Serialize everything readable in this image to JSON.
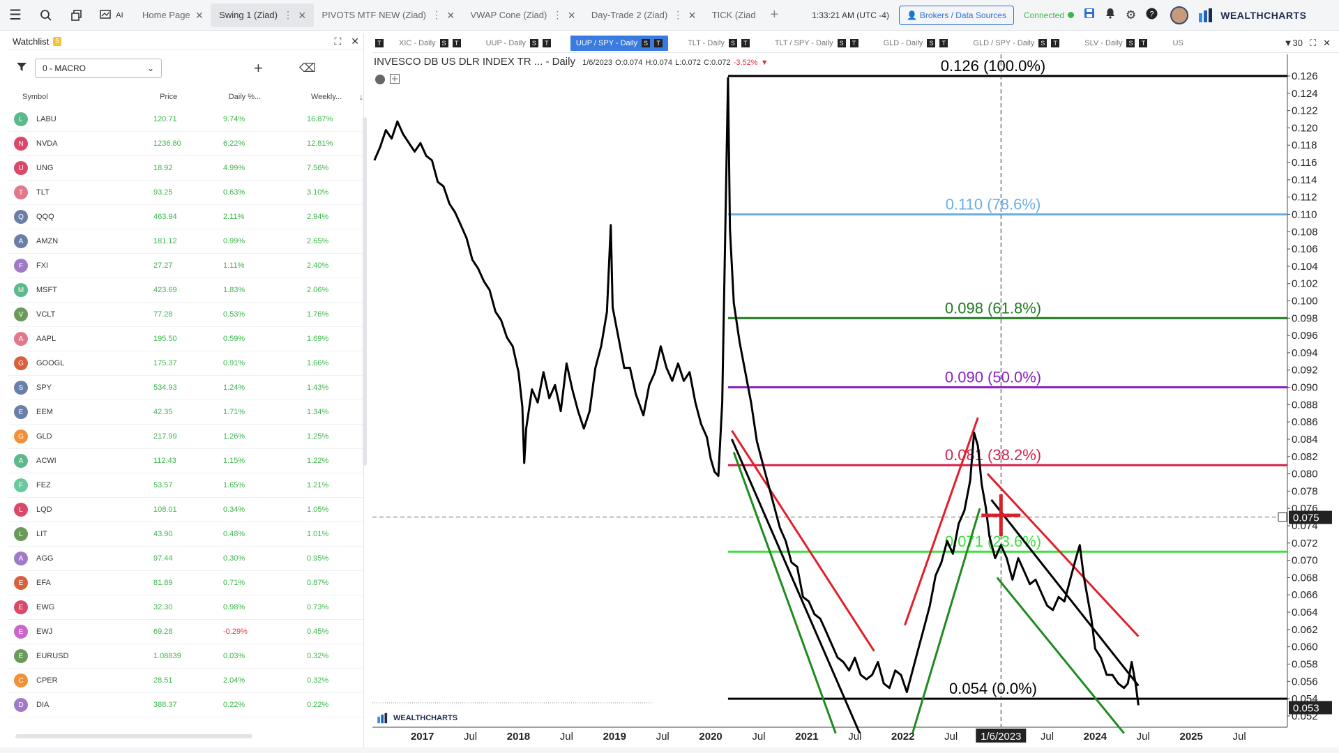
{
  "topbar": {
    "tabs": [
      {
        "label": "Home Page",
        "has_menu": false
      },
      {
        "label": "Swing 1 (Ziad)",
        "has_menu": true,
        "active": true
      },
      {
        "label": "PIVOTS MTF NEW (Ziad)",
        "has_menu": true
      },
      {
        "label": "VWAP Cone (Ziad)",
        "has_menu": true
      },
      {
        "label": "Day-Trade 2 (Ziad)",
        "has_menu": true
      },
      {
        "label": "TICK (Ziad",
        "has_menu": false
      }
    ],
    "clock": "1:33:21 AM  (UTC -4)",
    "brokers_label": "Brokers / Data Sources",
    "connection": "Connected",
    "brand": "WEALTHCHARTS",
    "ai_label": "AI"
  },
  "watchlist": {
    "title": "Watchlist",
    "badge": "5",
    "list_name": "0 - MACRO",
    "columns": [
      "Symbol",
      "Price",
      "Daily %...",
      "Weekly..."
    ],
    "rows": [
      {
        "sym": "LABU",
        "price": "120.71",
        "daily": "9.74%",
        "weekly": "16.87%",
        "color": "#5bb98c"
      },
      {
        "sym": "NVDA",
        "price": "1236.80",
        "daily": "6.22%",
        "weekly": "12.81%",
        "color": "#d94a6a"
      },
      {
        "sym": "UNG",
        "price": "18.92",
        "daily": "4.99%",
        "weekly": "7.56%",
        "color": "#d94a6a"
      },
      {
        "sym": "TLT",
        "price": "93.25",
        "daily": "0.63%",
        "weekly": "3.10%",
        "color": "#e07a8a"
      },
      {
        "sym": "QQQ",
        "price": "463.94",
        "daily": "2.11%",
        "weekly": "2.94%",
        "color": "#6a7fa8"
      },
      {
        "sym": "AMZN",
        "price": "181.12",
        "daily": "0.99%",
        "weekly": "2.65%",
        "color": "#6a7fa8"
      },
      {
        "sym": "FXI",
        "price": "27.27",
        "daily": "1.11%",
        "weekly": "2.40%",
        "color": "#a07ac8"
      },
      {
        "sym": "MSFT",
        "price": "423.69",
        "daily": "1.83%",
        "weekly": "2.06%",
        "color": "#5bb98c"
      },
      {
        "sym": "VCLT",
        "price": "77.28",
        "daily": "0.53%",
        "weekly": "1.76%",
        "color": "#6a9a5a"
      },
      {
        "sym": "AAPL",
        "price": "195.50",
        "daily": "0.59%",
        "weekly": "1.69%",
        "color": "#e07a8a"
      },
      {
        "sym": "GOOGL",
        "price": "175.37",
        "daily": "0.91%",
        "weekly": "1.66%",
        "color": "#d9603a"
      },
      {
        "sym": "SPY",
        "price": "534.93",
        "daily": "1.24%",
        "weekly": "1.43%",
        "color": "#6a7fa8"
      },
      {
        "sym": "EEM",
        "price": "42.35",
        "daily": "1.71%",
        "weekly": "1.34%",
        "color": "#6a7fa8"
      },
      {
        "sym": "GLD",
        "price": "217.99",
        "daily": "1.26%",
        "weekly": "1.25%",
        "color": "#f0913a"
      },
      {
        "sym": "ACWI",
        "price": "112.43",
        "daily": "1.15%",
        "weekly": "1.22%",
        "color": "#5bb98c"
      },
      {
        "sym": "FEZ",
        "price": "53.57",
        "daily": "1.65%",
        "weekly": "1.21%",
        "color": "#6ac8a0"
      },
      {
        "sym": "LQD",
        "price": "108.01",
        "daily": "0.34%",
        "weekly": "1.05%",
        "color": "#d94a6a"
      },
      {
        "sym": "LIT",
        "price": "43.90",
        "daily": "0.48%",
        "weekly": "1.01%",
        "color": "#6a9a5a"
      },
      {
        "sym": "AGG",
        "price": "97.44",
        "daily": "0.30%",
        "weekly": "0.95%",
        "color": "#a07ac8"
      },
      {
        "sym": "EFA",
        "price": "81.89",
        "daily": "0.71%",
        "weekly": "0.87%",
        "color": "#d9603a"
      },
      {
        "sym": "EWG",
        "price": "32.30",
        "daily": "0.98%",
        "weekly": "0.73%",
        "color": "#d94a6a"
      },
      {
        "sym": "EWJ",
        "price": "69.28",
        "daily": "-0.29%",
        "weekly": "0.45%",
        "color": "#c868c8",
        "daily_neg": true
      },
      {
        "sym": "EURUSD",
        "price": "1.08839",
        "daily": "0.03%",
        "weekly": "0.32%",
        "color": "#6a9a5a"
      },
      {
        "sym": "CPER",
        "price": "28.51",
        "daily": "2.04%",
        "weekly": "0.32%",
        "color": "#f0913a"
      },
      {
        "sym": "DIA",
        "price": "388.37",
        "daily": "0.22%",
        "weekly": "0.22%",
        "color": "#a07ac8"
      }
    ]
  },
  "chart_tabs": {
    "tabs": [
      "XIC - Daily",
      "UUP - Daily",
      "UUP / SPY - Daily",
      "TLT - Daily",
      "TLT / SPY - Daily",
      "GLD - Daily",
      "GLD / SPY - Daily",
      "SLV - Daily",
      "US"
    ],
    "active_index": 2,
    "count": "30",
    "first_badge": "T"
  },
  "chart_legend": {
    "name": "INVESCO DB US DLR INDEX TR ... - Daily",
    "date": "1/6/2023",
    "o": "O:0.074",
    "h": "H:0.074",
    "l": "L:0.072",
    "c": "C:0.072",
    "chg": "-3.52%"
  },
  "chart_data": {
    "type": "line",
    "y_ticks": [
      0.052,
      0.054,
      0.056,
      0.058,
      0.06,
      0.062,
      0.064,
      0.066,
      0.068,
      0.07,
      0.072,
      0.074,
      0.076,
      0.078,
      0.08,
      0.082,
      0.084,
      0.086,
      0.088,
      0.09,
      0.092,
      0.094,
      0.096,
      0.098,
      0.1,
      0.102,
      0.104,
      0.106,
      0.108,
      0.11,
      0.112,
      0.114,
      0.116,
      0.118,
      0.12,
      0.122,
      0.124,
      0.126
    ],
    "ylim": [
      0.0507,
      0.1285
    ],
    "x_labels": [
      "2017",
      "Jul",
      "2018",
      "Jul",
      "2019",
      "Jul",
      "2020",
      "Jul",
      "2021",
      "Jul",
      "2022",
      "Jul",
      "1/6/2023",
      "Jul",
      "2024",
      "Jul",
      "2025",
      "Jul"
    ],
    "fib_levels": [
      {
        "value": 0.126,
        "label": "0.126 (100.0%)",
        "color": "#000000"
      },
      {
        "value": 0.11,
        "label": "0.110 (78.6%)",
        "color": "#6aaee8"
      },
      {
        "value": 0.098,
        "label": "0.098 (61.8%)",
        "color": "#1f7a1f"
      },
      {
        "value": 0.09,
        "label": "0.090 (50.0%)",
        "color": "#8a1fc8"
      },
      {
        "value": 0.081,
        "label": "0.081 (38.2%)",
        "color": "#d61f4a"
      },
      {
        "value": 0.071,
        "label": "0.071 (23.6%)",
        "color": "#3de03d"
      },
      {
        "value": 0.054,
        "label": "0.054 (0.0%)",
        "color": "#000000"
      }
    ],
    "crosshair_price": "0.075",
    "crosshair_value": 0.075,
    "last_price": "0.053",
    "last_value": 0.053,
    "series": [
      {
        "values": [
          [
            2016.5,
            0.116
          ],
          [
            2016.56,
            0.118
          ],
          [
            2016.62,
            0.1195
          ],
          [
            2016.68,
            0.119
          ],
          [
            2016.74,
            0.1205
          ],
          [
            2016.8,
            0.1195
          ],
          [
            2016.86,
            0.118
          ],
          [
            2016.92,
            0.1175
          ],
          [
            2016.98,
            0.118
          ],
          [
            2017.04,
            0.117
          ],
          [
            2017.1,
            0.116
          ],
          [
            2017.16,
            0.114
          ],
          [
            2017.22,
            0.113
          ],
          [
            2017.28,
            0.1115
          ],
          [
            2017.34,
            0.11
          ],
          [
            2017.4,
            0.109
          ],
          [
            2017.46,
            0.107
          ],
          [
            2017.52,
            0.105
          ],
          [
            2017.58,
            0.1035
          ],
          [
            2017.64,
            0.1025
          ],
          [
            2017.7,
            0.101
          ],
          [
            2017.76,
            0.099
          ],
          [
            2017.82,
            0.0975
          ],
          [
            2017.88,
            0.096
          ],
          [
            2017.94,
            0.0945
          ],
          [
            2018.0,
            0.092
          ],
          [
            2018.04,
            0.0875
          ],
          [
            2018.06,
            0.0815
          ],
          [
            2018.08,
            0.085
          ],
          [
            2018.14,
            0.09
          ],
          [
            2018.2,
            0.088
          ],
          [
            2018.26,
            0.092
          ],
          [
            2018.32,
            0.0885
          ],
          [
            2018.38,
            0.0905
          ],
          [
            2018.44,
            0.087
          ],
          [
            2018.5,
            0.093
          ],
          [
            2018.56,
            0.0895
          ],
          [
            2018.62,
            0.0875
          ],
          [
            2018.68,
            0.085
          ],
          [
            2018.74,
            0.0875
          ],
          [
            2018.8,
            0.092
          ],
          [
            2018.86,
            0.095
          ],
          [
            2018.92,
            0.0985
          ],
          [
            2018.96,
            0.109
          ],
          [
            2018.98,
            0.099
          ],
          [
            2019.04,
            0.096
          ],
          [
            2019.1,
            0.092
          ],
          [
            2019.16,
            0.0925
          ],
          [
            2019.22,
            0.089
          ],
          [
            2019.3,
            0.087
          ],
          [
            2019.36,
            0.09
          ],
          [
            2019.42,
            0.092
          ],
          [
            2019.48,
            0.0945
          ],
          [
            2019.54,
            0.0925
          ],
          [
            2019.6,
            0.0905
          ],
          [
            2019.66,
            0.093
          ],
          [
            2019.72,
            0.0905
          ],
          [
            2019.78,
            0.092
          ],
          [
            2019.84,
            0.088
          ],
          [
            2019.9,
            0.086
          ],
          [
            2019.96,
            0.084
          ],
          [
            2020.0,
            0.082
          ],
          [
            2020.04,
            0.08
          ],
          [
            2020.08,
            0.08
          ],
          [
            2020.12,
            0.088
          ],
          [
            2020.18,
            0.126
          ],
          [
            2020.2,
            0.108
          ],
          [
            2020.24,
            0.1
          ],
          [
            2020.3,
            0.095
          ],
          [
            2020.36,
            0.092
          ],
          [
            2020.42,
            0.088
          ],
          [
            2020.48,
            0.084
          ],
          [
            2020.54,
            0.081
          ],
          [
            2020.6,
            0.079
          ],
          [
            2020.66,
            0.076
          ],
          [
            2020.72,
            0.074
          ],
          [
            2020.78,
            0.072
          ],
          [
            2020.84,
            0.07
          ],
          [
            2020.9,
            0.069
          ],
          [
            2020.96,
            0.066
          ],
          [
            2021.02,
            0.065
          ],
          [
            2021.08,
            0.064
          ],
          [
            2021.14,
            0.063
          ],
          [
            2021.2,
            0.062
          ],
          [
            2021.26,
            0.06
          ],
          [
            2021.32,
            0.059
          ],
          [
            2021.38,
            0.058
          ],
          [
            2021.44,
            0.0575
          ],
          [
            2021.5,
            0.0585
          ],
          [
            2021.56,
            0.057
          ],
          [
            2021.62,
            0.056
          ],
          [
            2021.68,
            0.057
          ],
          [
            2021.74,
            0.058
          ],
          [
            2021.8,
            0.056
          ],
          [
            2021.86,
            0.055
          ],
          [
            2021.92,
            0.0575
          ],
          [
            2021.98,
            0.0565
          ],
          [
            2022.04,
            0.055
          ],
          [
            2022.1,
            0.057
          ],
          [
            2022.16,
            0.06
          ],
          [
            2022.22,
            0.062
          ],
          [
            2022.28,
            0.065
          ],
          [
            2022.34,
            0.068
          ],
          [
            2022.4,
            0.07
          ],
          [
            2022.46,
            0.072
          ],
          [
            2022.52,
            0.071
          ],
          [
            2022.58,
            0.074
          ],
          [
            2022.64,
            0.076
          ],
          [
            2022.7,
            0.079
          ],
          [
            2022.74,
            0.085
          ],
          [
            2022.78,
            0.083
          ],
          [
            2022.82,
            0.079
          ],
          [
            2022.86,
            0.076
          ],
          [
            2022.9,
            0.073
          ],
          [
            2022.96,
            0.07
          ],
          [
            2023.02,
            0.072
          ],
          [
            2023.08,
            0.07
          ],
          [
            2023.14,
            0.068
          ],
          [
            2023.2,
            0.07
          ],
          [
            2023.26,
            0.069
          ],
          [
            2023.32,
            0.067
          ],
          [
            2023.38,
            0.068
          ],
          [
            2023.44,
            0.066
          ],
          [
            2023.5,
            0.065
          ],
          [
            2023.56,
            0.064
          ],
          [
            2023.62,
            0.066
          ],
          [
            2023.68,
            0.065
          ],
          [
            2023.74,
            0.068
          ],
          [
            2023.8,
            0.07
          ],
          [
            2023.84,
            0.072
          ],
          [
            2023.88,
            0.068
          ],
          [
            2023.92,
            0.066
          ],
          [
            2023.96,
            0.063
          ],
          [
            2024.0,
            0.06
          ],
          [
            2024.06,
            0.0585
          ],
          [
            2024.12,
            0.057
          ],
          [
            2024.18,
            0.0565
          ],
          [
            2024.24,
            0.056
          ],
          [
            2024.3,
            0.055
          ],
          [
            2024.34,
            0.056
          ],
          [
            2024.38,
            0.058
          ],
          [
            2024.42,
            0.056
          ],
          [
            2024.45,
            0.053
          ]
        ]
      }
    ],
    "trendlines": [
      {
        "color": "#e01f2a",
        "from": [
          2020.22,
          0.085
        ],
        "to": [
          2021.7,
          0.0595
        ]
      },
      {
        "color": "#e01f2a",
        "from": [
          2022.02,
          0.0625
        ],
        "to": [
          2022.78,
          0.0865
        ]
      },
      {
        "color": "#e01f2a",
        "from": [
          2022.88,
          0.08
        ],
        "to": [
          2024.45,
          0.0612
        ]
      },
      {
        "color": "#1f8a1f",
        "from": [
          2020.24,
          0.0825
        ],
        "to": [
          2021.3,
          0.05
        ]
      },
      {
        "color": "#1f8a1f",
        "from": [
          2022.1,
          0.05
        ],
        "to": [
          2022.8,
          0.076
        ]
      },
      {
        "color": "#1f8a1f",
        "from": [
          2022.98,
          0.068
        ],
        "to": [
          2024.3,
          0.05
        ]
      },
      {
        "color": "#000000",
        "from": [
          2020.22,
          0.084
        ],
        "to": [
          2021.55,
          0.05
        ]
      },
      {
        "color": "#000000",
        "from": [
          2022.92,
          0.077
        ],
        "to": [
          2024.45,
          0.0555
        ]
      }
    ]
  }
}
